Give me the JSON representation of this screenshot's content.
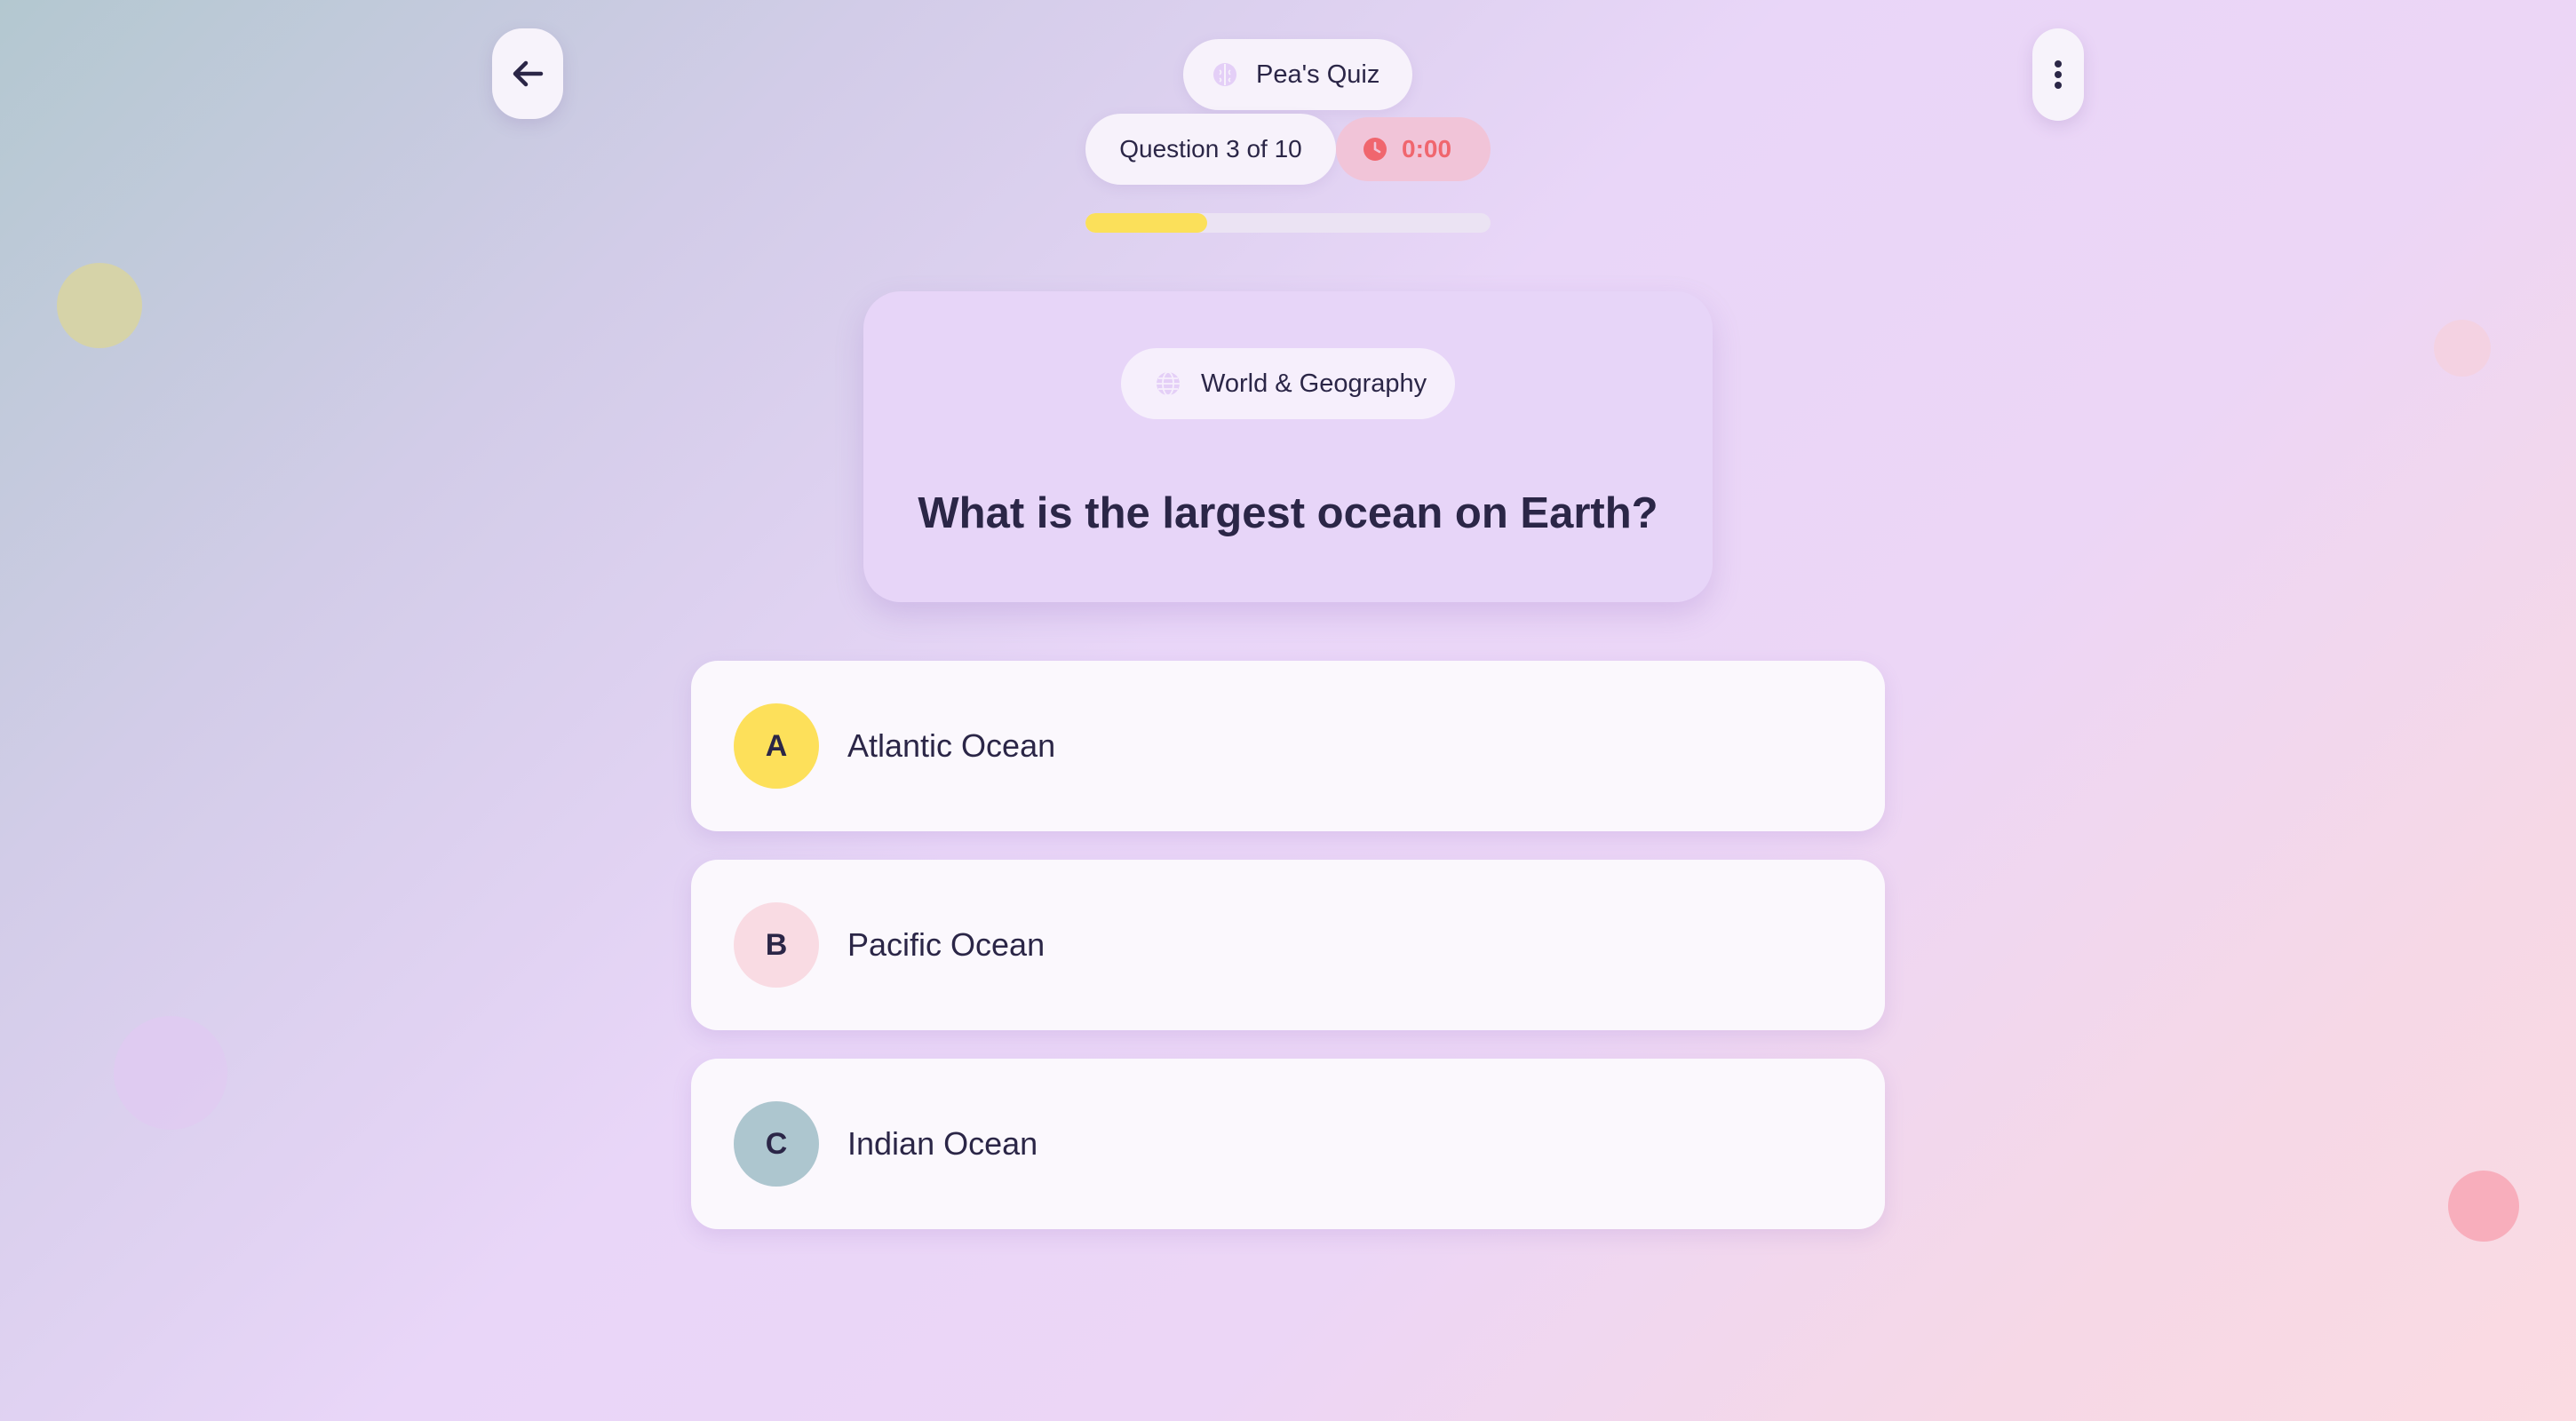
{
  "header": {
    "brand": {
      "label": "Pea's Quiz",
      "icon": "brain-icon"
    },
    "back_button": {
      "icon": "arrow-left-icon"
    },
    "more_button": {
      "icon": "more-vertical-icon"
    }
  },
  "progress": {
    "question_label": "Question 3 of 10",
    "timer": "0:00",
    "timer_icon": "clock-icon",
    "fraction": 0.3
  },
  "question": {
    "category": "World & Geography",
    "category_icon": "globe-icon",
    "text": "What is the largest ocean on Earth?"
  },
  "options": [
    {
      "letter": "A",
      "text": "Atlantic Ocean",
      "color": "#fde05a"
    },
    {
      "letter": "B",
      "text": "Pacific Ocean",
      "color": "#f9dbe3"
    },
    {
      "letter": "C",
      "text": "Indian Ocean",
      "color": "#adc6cf"
    }
  ],
  "colors": {
    "progress_fill": "#fbe05a",
    "timer_text": "#f0666e",
    "timer_bg": "#f1c4d8",
    "card_bg": "#e7d5f8",
    "text_primary": "#2b2647"
  }
}
